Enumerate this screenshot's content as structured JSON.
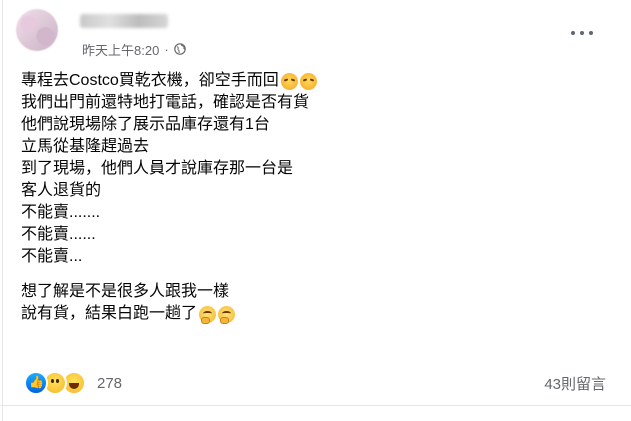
{
  "post": {
    "timestamp": "昨天上午8:20",
    "visibility_icon": "globe-icon",
    "more_icon": "more-options-icon",
    "lines": [
      "專程去Costco買乾衣機，卻空手而回",
      "我們出門前還特地打電話，確認是否有貨",
      "他們說現場除了展示品庫存還有1台",
      "立馬從基隆趕過去",
      "到了現場，他們人員才說庫存那一台是",
      "客人退貨的",
      "不能賣.......",
      "不能賣......",
      "不能賣...",
      "想了解是不是很多人跟我一樣",
      "說有貨，結果白跑一趟了"
    ],
    "line1_emojis": [
      "steaming-face-emoji",
      "steaming-face-emoji"
    ],
    "line11_emojis": [
      "thinking-face-emoji",
      "thinking-face-emoji"
    ]
  },
  "footer": {
    "reaction_icons": [
      "like-reaction-icon",
      "wow-reaction-icon",
      "haha-reaction-icon"
    ],
    "reaction_count": "278",
    "comment_count": "43則留言"
  },
  "colors": {
    "secondary_text": "#65676b",
    "primary_text": "#050505",
    "like_blue": "#1877f2"
  }
}
